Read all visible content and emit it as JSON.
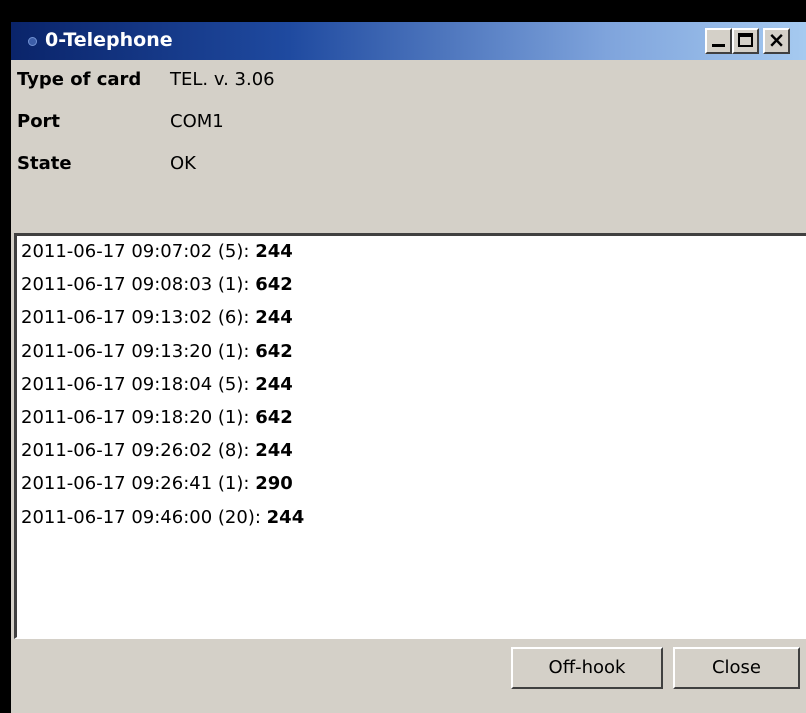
{
  "window": {
    "title": "0-Telephone",
    "caption_buttons": {
      "minimize": "minimize-icon",
      "maximize": "maximize-icon",
      "close": "×"
    }
  },
  "info": {
    "type_label": "Type of card",
    "type_value": "TEL. v. 3.06",
    "port_label": "Port",
    "port_value": "COM1",
    "state_label": "State",
    "state_value": "OK"
  },
  "log": [
    {
      "prefix": "2011-06-17 09:07:02 (5): ",
      "value": "244"
    },
    {
      "prefix": "2011-06-17 09:08:03 (1): ",
      "value": "642"
    },
    {
      "prefix": "2011-06-17 09:13:02 (6): ",
      "value": "244"
    },
    {
      "prefix": "2011-06-17 09:13:20 (1): ",
      "value": "642"
    },
    {
      "prefix": "2011-06-17 09:18:04 (5): ",
      "value": "244"
    },
    {
      "prefix": "2011-06-17 09:18:20 (1): ",
      "value": "642"
    },
    {
      "prefix": "2011-06-17 09:26:02 (8): ",
      "value": "244"
    },
    {
      "prefix": "2011-06-17 09:26:41 (1): ",
      "value": "290"
    },
    {
      "prefix": "2011-06-17 09:46:00 (20): ",
      "value": "244"
    }
  ],
  "buttons": {
    "offhook": "Off-hook",
    "close": "Close"
  },
  "colors": {
    "titlebar_start": "#0a246a",
    "titlebar_end": "#a6caf0",
    "face": "#d4d0c8"
  }
}
